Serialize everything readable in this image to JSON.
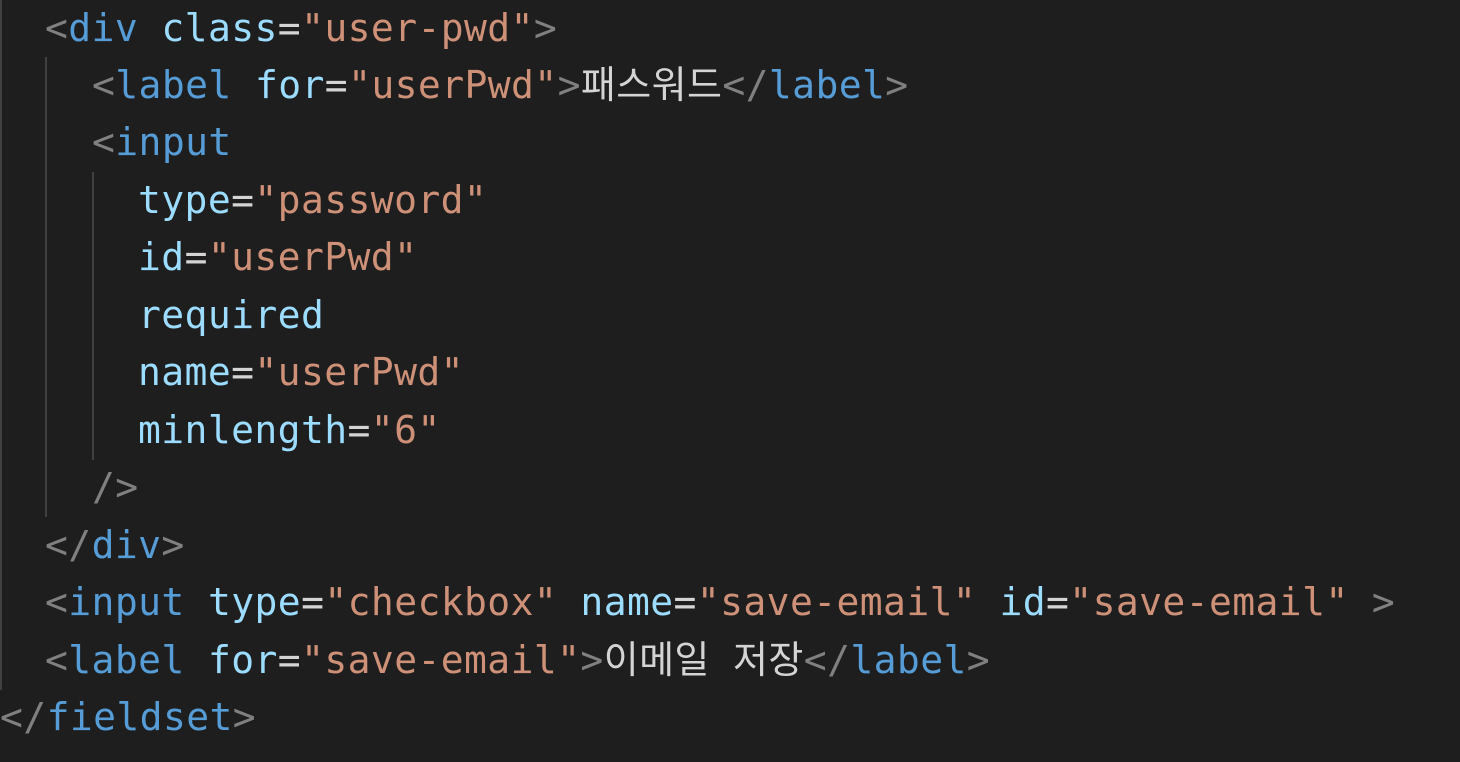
{
  "editor": {
    "language": "html",
    "theme_colors": {
      "background": "#1e1e1e",
      "tag": "#569cd6",
      "attribute": "#9cdcfe",
      "string": "#ce9178",
      "punctuation": "#808080",
      "text": "#d4d4d4"
    },
    "lines": [
      {
        "tokens": [
          "<",
          "div",
          "class",
          "=",
          "\"user-pwd\"",
          ">"
        ]
      },
      {
        "tokens": [
          "<",
          "label",
          "for",
          "=",
          "\"userPwd\"",
          ">",
          "패스워드",
          "</",
          "label",
          ">"
        ]
      },
      {
        "tokens": [
          "<",
          "input"
        ]
      },
      {
        "tokens": [
          "type",
          "=",
          "\"password\""
        ]
      },
      {
        "tokens": [
          "id",
          "=",
          "\"userPwd\""
        ]
      },
      {
        "tokens": [
          "required"
        ]
      },
      {
        "tokens": [
          "name",
          "=",
          "\"userPwd\""
        ]
      },
      {
        "tokens": [
          "minlength",
          "=",
          "\"6\""
        ]
      },
      {
        "tokens": [
          "/>"
        ]
      },
      {
        "tokens": [
          "</",
          "div",
          ">"
        ]
      },
      {
        "tokens": [
          "<",
          "input",
          "type",
          "=",
          "\"checkbox\"",
          "name",
          "=",
          "\"save-email\"",
          "id",
          "=",
          "\"save-email\"",
          ">"
        ]
      },
      {
        "tokens": [
          "<",
          "label",
          "for",
          "=",
          "\"save-email\"",
          ">",
          "이메일 저장",
          "</",
          "label",
          ">"
        ]
      },
      {
        "tokens": [
          "</",
          "fieldset",
          ">"
        ]
      }
    ]
  }
}
